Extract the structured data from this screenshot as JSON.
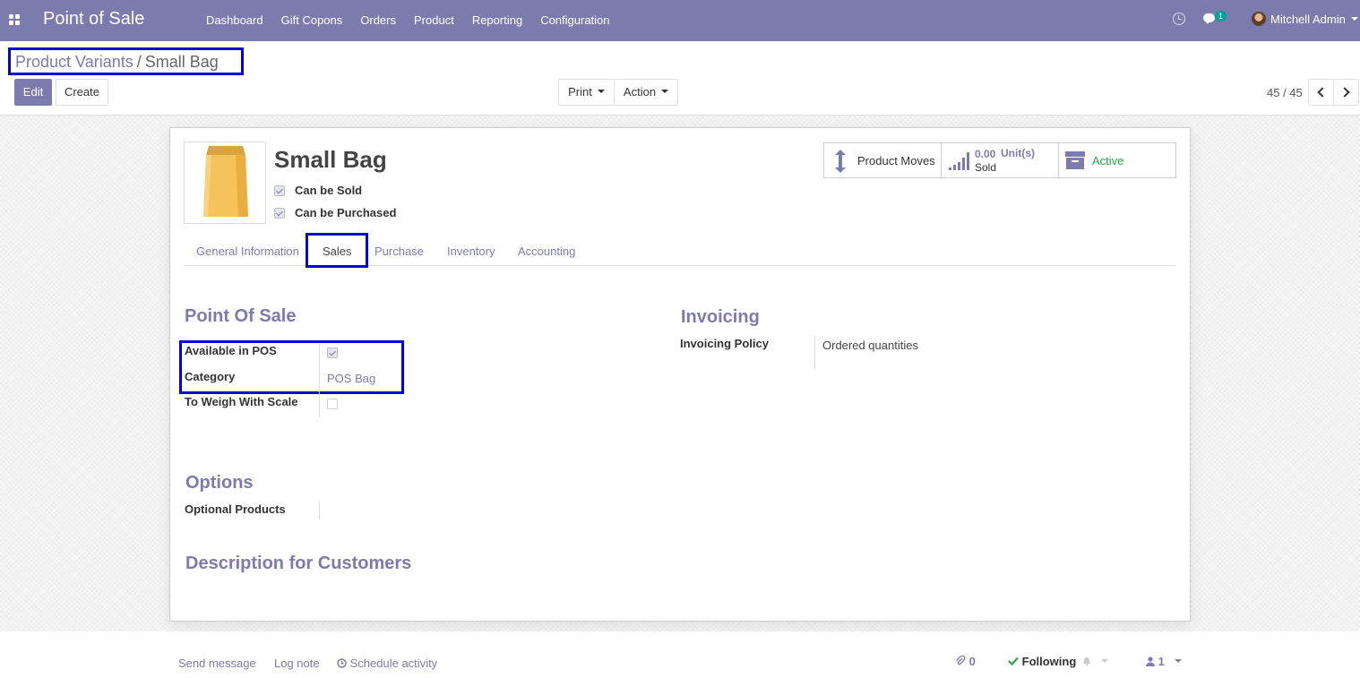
{
  "navbar": {
    "app_title": "Point of Sale",
    "menu": [
      "Dashboard",
      "Gift Copons",
      "Orders",
      "Product",
      "Reporting",
      "Configuration"
    ],
    "chat_badge": "1",
    "user_name": "Mitchell Admin"
  },
  "breadcrumb": {
    "parent": "Product Variants",
    "separator": "/",
    "current": "Small Bag"
  },
  "toolbar": {
    "edit_label": "Edit",
    "create_label": "Create",
    "print_label": "Print",
    "action_label": "Action"
  },
  "pager": {
    "value": "45 / 45"
  },
  "product": {
    "name": "Small Bag",
    "can_be_sold_label": "Can be Sold",
    "can_be_sold": true,
    "can_be_purchased_label": "Can be Purchased",
    "can_be_purchased": true
  },
  "smart_buttons": {
    "moves_label": "Product Moves",
    "sold_value": "0.00",
    "sold_unit": "Unit(s)",
    "sold_label": "Sold",
    "active_label": "Active"
  },
  "tabs": [
    "General Information",
    "Sales",
    "Purchase",
    "Inventory",
    "Accounting"
  ],
  "active_tab": "Sales",
  "pos_section": {
    "title": "Point Of Sale",
    "available_label": "Available in POS",
    "available": true,
    "category_label": "Category",
    "category_value": "POS Bag",
    "weigh_label": "To Weigh With Scale",
    "weigh": false
  },
  "invoicing_section": {
    "title": "Invoicing",
    "policy_label": "Invoicing Policy",
    "policy_value": "Ordered quantities"
  },
  "options_section": {
    "title": "Options",
    "optional_label": "Optional Products"
  },
  "description_section": {
    "title": "Description for Customers"
  },
  "chatter": {
    "send_message": "Send message",
    "log_note": "Log note",
    "schedule_activity": "Schedule activity",
    "attachments_count": "0",
    "following_label": "Following",
    "followers_count": "1"
  },
  "colors": {
    "brand": "#7c7bad",
    "highlight": "#0000d6",
    "active_green": "#28a745"
  }
}
